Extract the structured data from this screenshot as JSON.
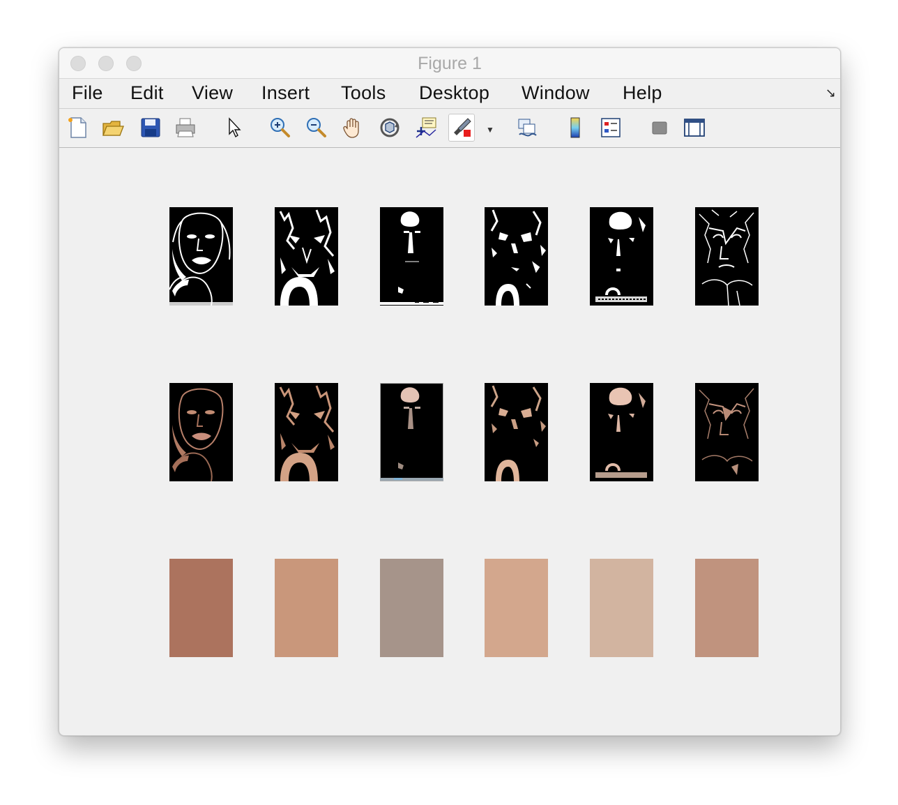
{
  "window": {
    "title": "Figure 1"
  },
  "menu": {
    "items": [
      "File",
      "Edit",
      "View",
      "Insert",
      "Tools",
      "Desktop",
      "Window",
      "Help"
    ]
  },
  "toolbar": {
    "icons": [
      "new-figure-icon",
      "open-file-icon",
      "save-icon",
      "print-icon",
      "edit-plot-arrow-icon",
      "zoom-in-icon",
      "zoom-out-icon",
      "pan-hand-icon",
      "rotate-3d-icon",
      "data-cursor-icon",
      "brush-icon",
      "link-plot-icon",
      "insert-colorbar-icon",
      "insert-legend-icon",
      "hide-plot-tools-icon",
      "show-plot-tools-icon"
    ]
  },
  "figure": {
    "rows": [
      {
        "kind": "binary-mask",
        "count": 6
      },
      {
        "kind": "masked-color-image",
        "count": 6
      },
      {
        "kind": "color-swatch",
        "count": 6
      }
    ],
    "swatch_colors": [
      "#ac735e",
      "#c9977b",
      "#a6948a",
      "#d3a78d",
      "#d2b4a0",
      "#c0937e"
    ]
  }
}
